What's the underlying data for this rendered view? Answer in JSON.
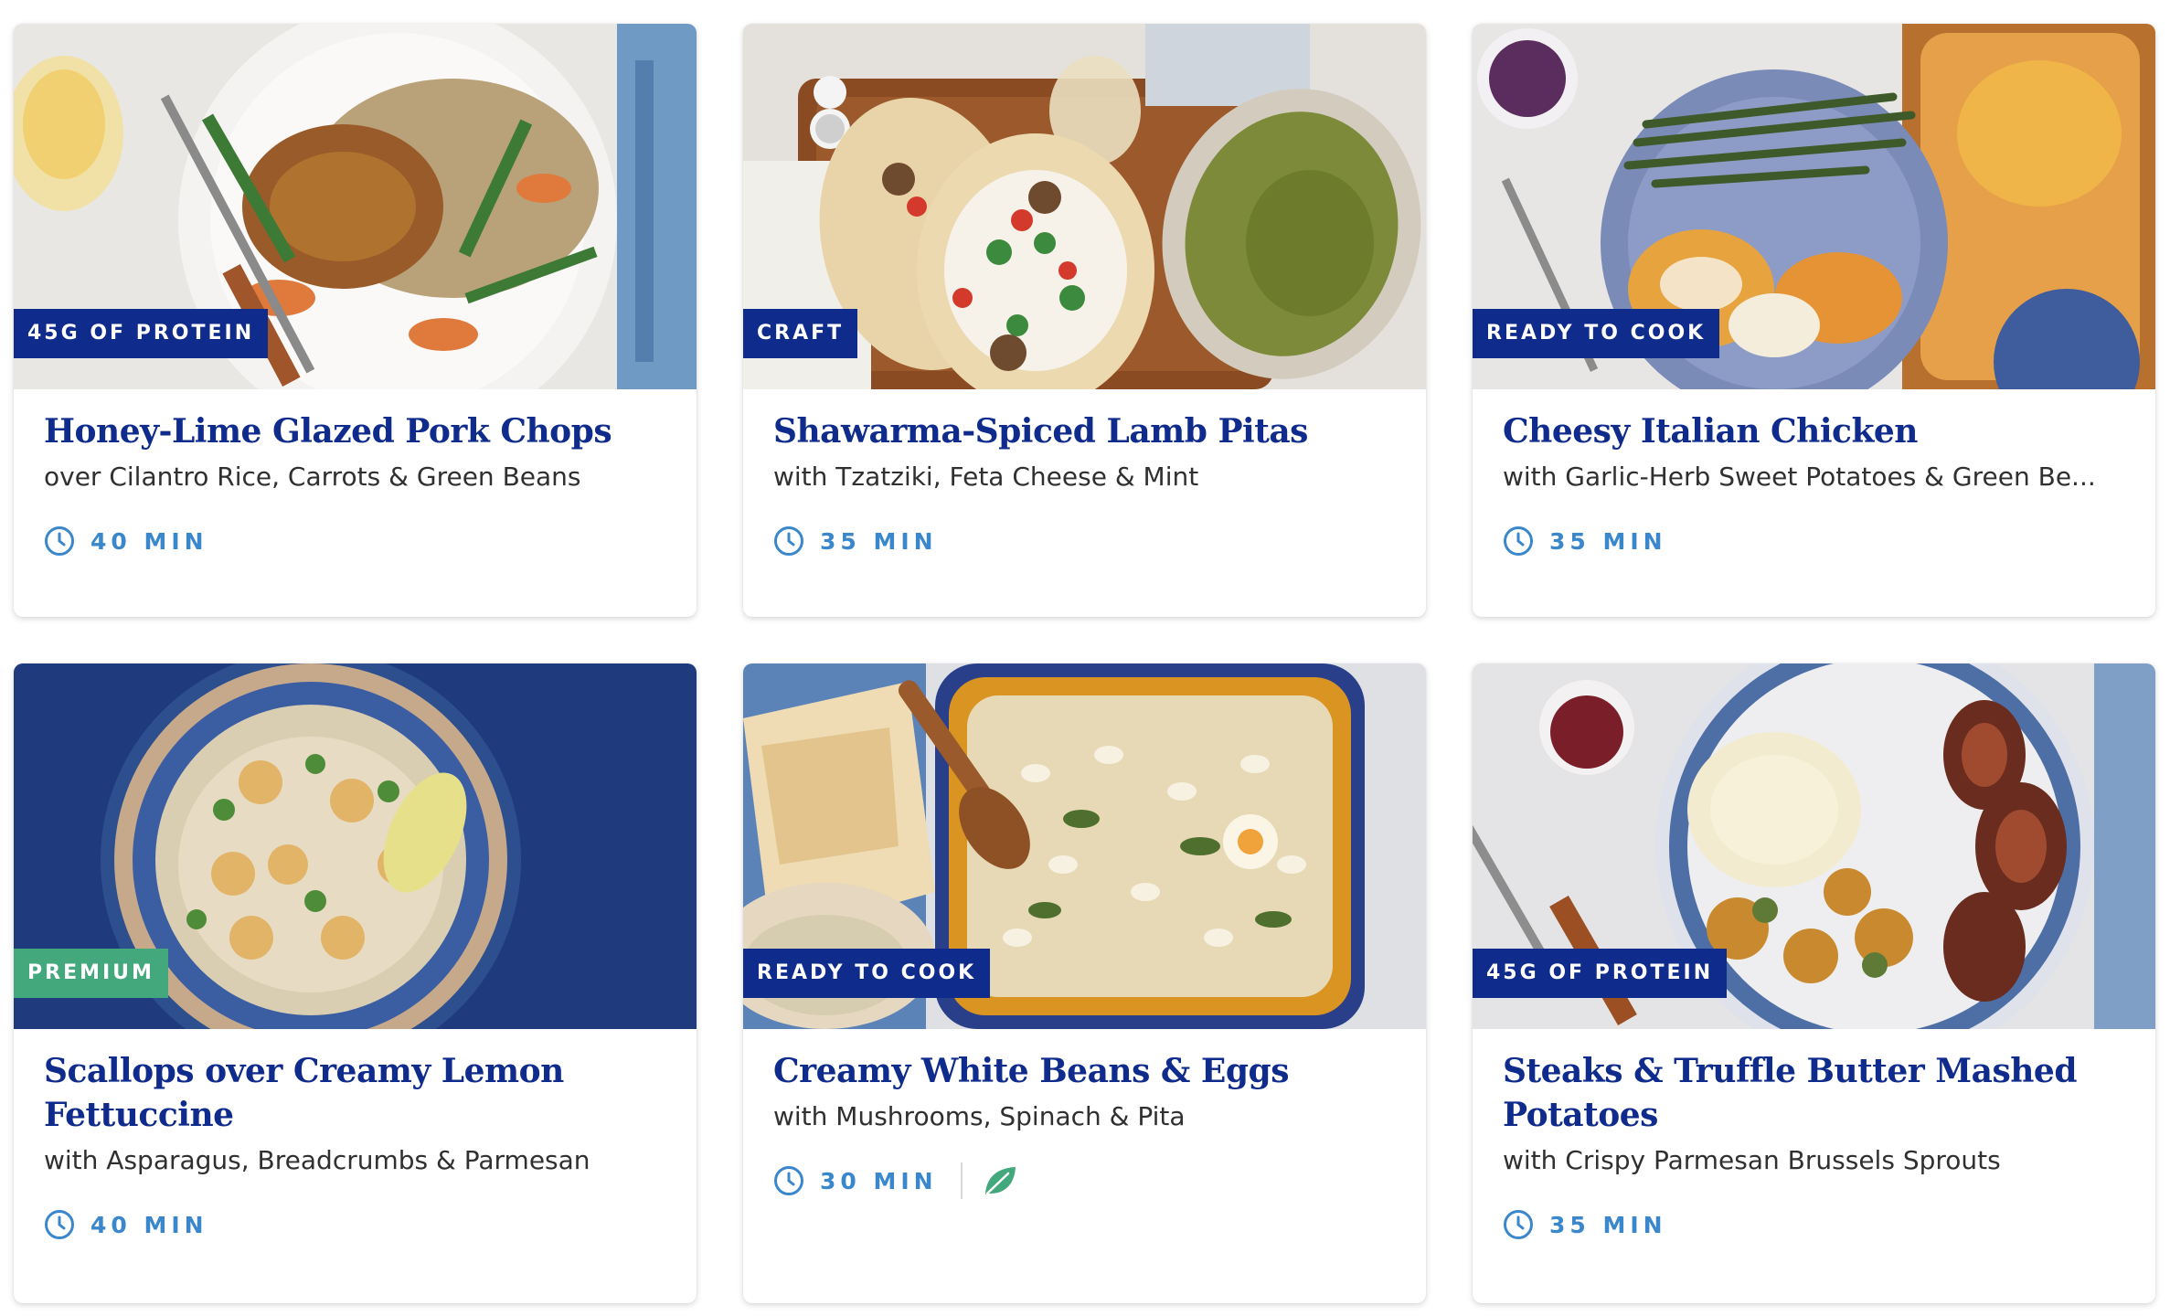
{
  "colors": {
    "title": "#0f2b8c",
    "badge_navy": "#0f2b8c",
    "badge_green": "#43a87c",
    "time": "#3a87cc",
    "subtitle": "#303030"
  },
  "recipes": [
    {
      "badge": "45G OF PROTEIN",
      "badge_color": "navy",
      "title": "Honey-Lime Glazed Pork Chops",
      "subtitle": "over Cilantro Rice, Carrots & Green Beans",
      "time": "40 MIN",
      "icon": "clock-icon"
    },
    {
      "badge": "CRAFT",
      "badge_color": "navy",
      "title": "Shawarma-Spiced Lamb Pitas",
      "subtitle": "with Tzatziki, Feta Cheese & Mint",
      "time": "35 MIN",
      "icon": "clock-icon"
    },
    {
      "badge": "READY TO COOK",
      "badge_color": "navy",
      "title": "Cheesy Italian Chicken",
      "subtitle": "with Garlic-Herb Sweet Potatoes & Green Be...",
      "time": "35 MIN",
      "icon": "clock-icon"
    },
    {
      "badge": "PREMIUM",
      "badge_color": "green",
      "title": "Scallops over Creamy Lemon Fettuccine",
      "subtitle": "with Asparagus, Breadcrumbs & Parmesan",
      "time": "40 MIN",
      "icon": "clock-icon"
    },
    {
      "badge": "READY TO COOK",
      "badge_color": "navy",
      "title": "Creamy White Beans & Eggs",
      "subtitle": "with Mushrooms, Spinach & Pita",
      "time": "30 MIN",
      "icon": "clock-icon",
      "extra_icon": "leaf-icon"
    },
    {
      "badge": "45G OF PROTEIN",
      "badge_color": "navy",
      "title": "Steaks & Truffle Butter Mashed Potatoes",
      "subtitle": "with Crispy Parmesan Brussels Sprouts",
      "time": "35 MIN",
      "icon": "clock-icon"
    }
  ]
}
